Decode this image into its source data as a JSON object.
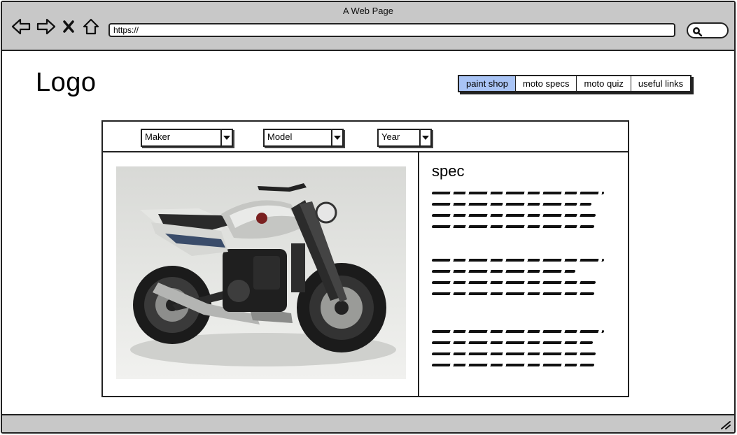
{
  "window": {
    "title": "A Web Page"
  },
  "nav": {
    "back_icon": "back-arrow-icon",
    "forward_icon": "forward-arrow-icon",
    "stop_icon": "close-icon",
    "home_icon": "home-icon"
  },
  "address": {
    "value": "https://"
  },
  "logo": {
    "text": "Logo"
  },
  "tabs": [
    {
      "label": "paint shop",
      "active": true
    },
    {
      "label": "moto specs",
      "active": false
    },
    {
      "label": "moto quiz",
      "active": false
    },
    {
      "label": "useful links",
      "active": false
    }
  ],
  "filters": {
    "maker": "Maker",
    "model": "Model",
    "year": "Year"
  },
  "spec": {
    "title": "spec"
  },
  "colors": {
    "active_tab": "#a9c4f5",
    "chrome": "#c8c8c8"
  }
}
